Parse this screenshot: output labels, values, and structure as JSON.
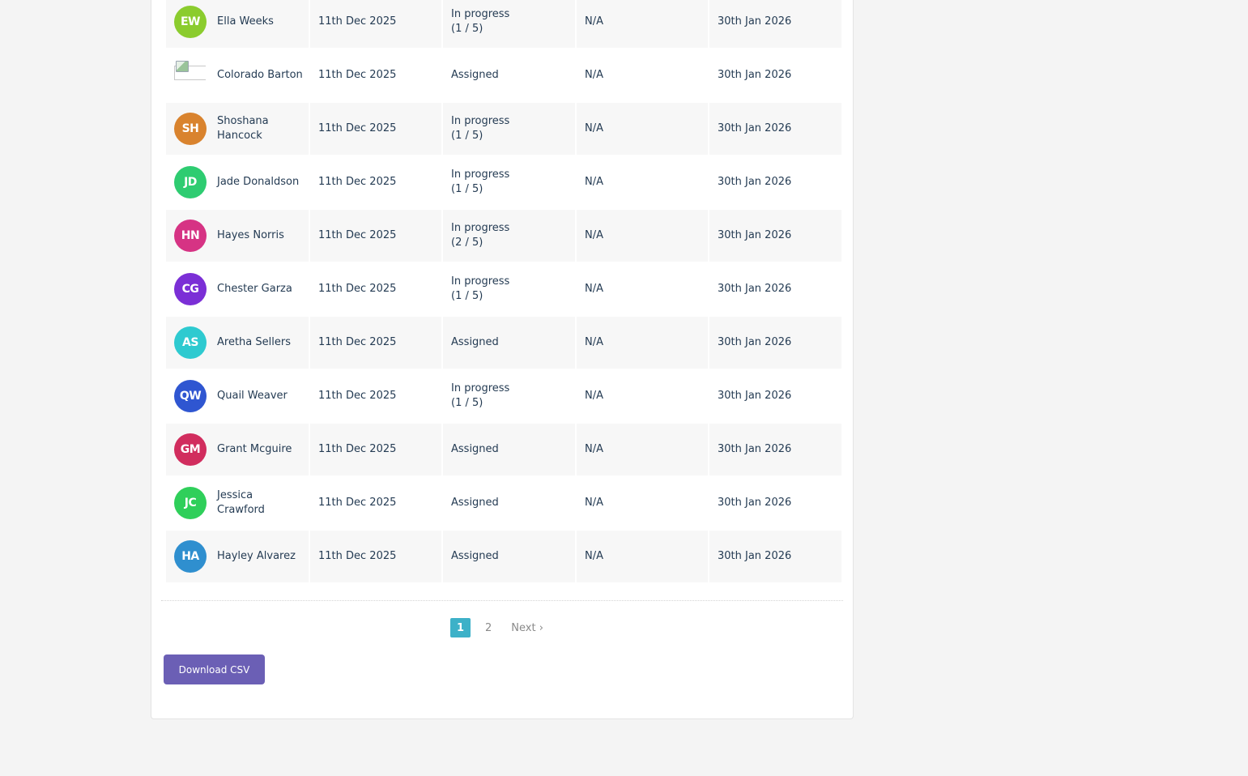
{
  "table": {
    "rows": [
      {
        "initials": "EW",
        "avatar_color": "#8bcc2e",
        "name": "Ella Weeks",
        "assigned": "11th Dec 2025",
        "status": "In progress\n(1 / 5)",
        "score": "N/A",
        "due": "30th Jan 2026",
        "avatar_broken": false
      },
      {
        "initials": "",
        "avatar_color": "",
        "name": "Colorado Barton",
        "assigned": "11th Dec 2025",
        "status": "Assigned",
        "score": "N/A",
        "due": "30th Jan 2026",
        "avatar_broken": true
      },
      {
        "initials": "SH",
        "avatar_color": "#d9832e",
        "name": "Shoshana Hancock",
        "assigned": "11th Dec 2025",
        "status": "In progress\n(1 / 5)",
        "score": "N/A",
        "due": "30th Jan 2026",
        "avatar_broken": false
      },
      {
        "initials": "JD",
        "avatar_color": "#2ecc71",
        "name": "Jade Donaldson",
        "assigned": "11th Dec 2025",
        "status": "In progress\n(1 / 5)",
        "score": "N/A",
        "due": "30th Jan 2026",
        "avatar_broken": false
      },
      {
        "initials": "HN",
        "avatar_color": "#d63384",
        "name": "Hayes Norris",
        "assigned": "11th Dec 2025",
        "status": "In progress\n(2 / 5)",
        "score": "N/A",
        "due": "30th Jan 2026",
        "avatar_broken": false
      },
      {
        "initials": "CG",
        "avatar_color": "#7b2fd6",
        "name": "Chester Garza",
        "assigned": "11th Dec 2025",
        "status": "In progress\n(1 / 5)",
        "score": "N/A",
        "due": "30th Jan 2026",
        "avatar_broken": false
      },
      {
        "initials": "AS",
        "avatar_color": "#2ecad0",
        "name": "Aretha Sellers",
        "assigned": "11th Dec 2025",
        "status": "Assigned",
        "score": "N/A",
        "due": "30th Jan 2026",
        "avatar_broken": false
      },
      {
        "initials": "QW",
        "avatar_color": "#2f56d1",
        "name": "Quail Weaver",
        "assigned": "11th Dec 2025",
        "status": "In progress\n(1 / 5)",
        "score": "N/A",
        "due": "30th Jan 2026",
        "avatar_broken": false
      },
      {
        "initials": "GM",
        "avatar_color": "#d12d5e",
        "name": "Grant Mcguire",
        "assigned": "11th Dec 2025",
        "status": "Assigned",
        "score": "N/A",
        "due": "30th Jan 2026",
        "avatar_broken": false
      },
      {
        "initials": "JC",
        "avatar_color": "#2fcf5a",
        "name": "Jessica Crawford",
        "assigned": "11th Dec 2025",
        "status": "Assigned",
        "score": "N/A",
        "due": "30th Jan 2026",
        "avatar_broken": false
      },
      {
        "initials": "HA",
        "avatar_color": "#2f8fcf",
        "name": "Hayley Alvarez",
        "assigned": "11th Dec 2025",
        "status": "Assigned",
        "score": "N/A",
        "due": "30th Jan 2026",
        "avatar_broken": false
      }
    ]
  },
  "pagination": {
    "current": "1",
    "pages": [
      "2"
    ],
    "next_label": "Next ›"
  },
  "actions": {
    "download_label": "Download CSV",
    "download_color": "#6b5fb5"
  },
  "colors": {
    "page_background": "#f4f4f4",
    "row_shade": "#f7f7f7",
    "pagination_active": "#3db1c8"
  }
}
